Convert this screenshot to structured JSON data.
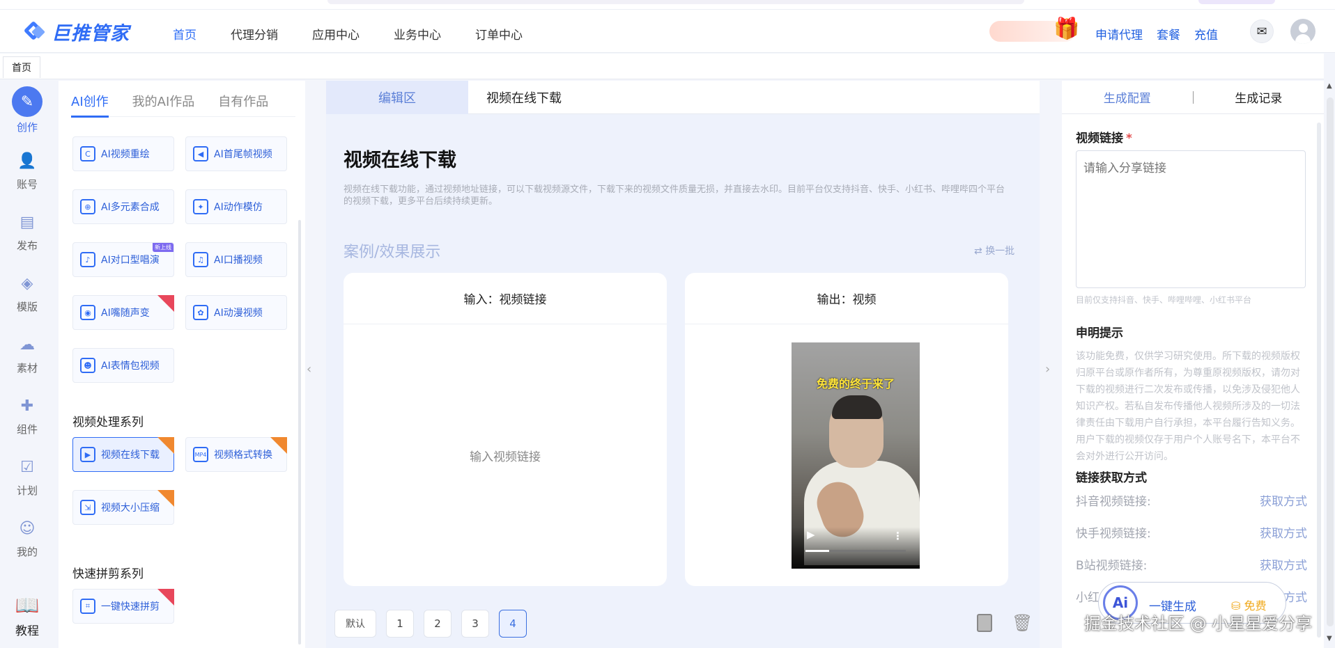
{
  "header": {
    "logo": "巨推管家",
    "nav": [
      "首页",
      "代理分销",
      "应用中心",
      "业务中心",
      "订单中心"
    ],
    "actions": [
      "申请代理",
      "套餐",
      "充值"
    ]
  },
  "tabbar": {
    "tab": "首页"
  },
  "rail": [
    {
      "label": "创作",
      "icon": "pen-icon"
    },
    {
      "label": "账号",
      "icon": "user-add-icon"
    },
    {
      "label": "发布",
      "icon": "publish-icon"
    },
    {
      "label": "模版",
      "icon": "layers-icon"
    },
    {
      "label": "素材",
      "icon": "cloud-upload-icon"
    },
    {
      "label": "组件",
      "icon": "puzzle-icon"
    },
    {
      "label": "计划",
      "icon": "calendar-check-icon"
    },
    {
      "label": "我的",
      "icon": "person-icon"
    },
    {
      "label": "教程",
      "icon": "book-icon"
    }
  ],
  "left": {
    "tabs": [
      "AI创作",
      "我的AI作品",
      "自有作品"
    ],
    "tools": [
      {
        "label": "AI视频重绘"
      },
      {
        "label": "AI首尾帧视频"
      },
      {
        "label": "AI多元素合成"
      },
      {
        "label": "AI动作模仿"
      },
      {
        "label": "AI对口型唱演",
        "tag": "新上线"
      },
      {
        "label": "AI口播视频"
      },
      {
        "label": "AI嘴随声变"
      },
      {
        "label": "AI动漫视频"
      },
      {
        "label": "AI表情包视频"
      }
    ],
    "section_video": "视频处理系列",
    "video_tools": [
      {
        "label": "视频在线下载"
      },
      {
        "label": "视频格式转换"
      },
      {
        "label": "视频大小压缩"
      }
    ],
    "section_quick": "快速拼剪系列",
    "quick_tools": [
      {
        "label": "一键快速拼剪"
      }
    ]
  },
  "center": {
    "tabs": [
      "编辑区",
      "视频在线下载"
    ],
    "title": "视频在线下载",
    "desc": "视频在线下载功能，通过视频地址链接，可以下载视频源文件，下载下来的视频文件质量无损，并直接去水印。目前平台仅支持抖音、快手、小红书、哔哩哔四个平台的视频下载，更多平台后续持续更新。",
    "cases": "案例/效果展示",
    "swap": "换一批",
    "input_card": {
      "title": "输入：视频链接",
      "hint": "输入视频链接"
    },
    "output_card": {
      "title": "输出：视频",
      "caption": "免费的终于来了"
    },
    "pager": [
      "默认",
      "1",
      "2",
      "3",
      "4"
    ]
  },
  "right": {
    "tabs": [
      "生成配置",
      "生成记录"
    ],
    "link_label": "视频链接",
    "required": "*",
    "placeholder": "请输入分享链接",
    "platform_hint": "目前仅支持抖音、快手、哔哩哔哩、小红书平台",
    "decl_title": "申明提示",
    "decl_text": "该功能免费，仅供学习研究使用。所下载的视频版权归原平台或原作者所有，为尊重原视频版权，请勿对下载的视频进行二次发布或传播，以免涉及侵犯他人知识产权。若私自发布传播他人视频所涉及的一切法律责任由下载用户自行承担，本平台履行告知义务。用户下载的视频仅存于用户个人账号名下，本平台不会对外进行公开访问。",
    "method_title": "链接获取方式",
    "methods": [
      {
        "label": "抖音视频链接:",
        "action": "获取方式"
      },
      {
        "label": "快手视频链接:",
        "action": "获取方式"
      },
      {
        "label": "B站视频链接:",
        "action": "获取方式"
      },
      {
        "label": "小红",
        "action": "方式"
      }
    ]
  },
  "floating": {
    "ai": "Ai",
    "generate": "一键生成",
    "free": "免费"
  },
  "watermark": "掘金技术社区 @ 小星星爱分享"
}
